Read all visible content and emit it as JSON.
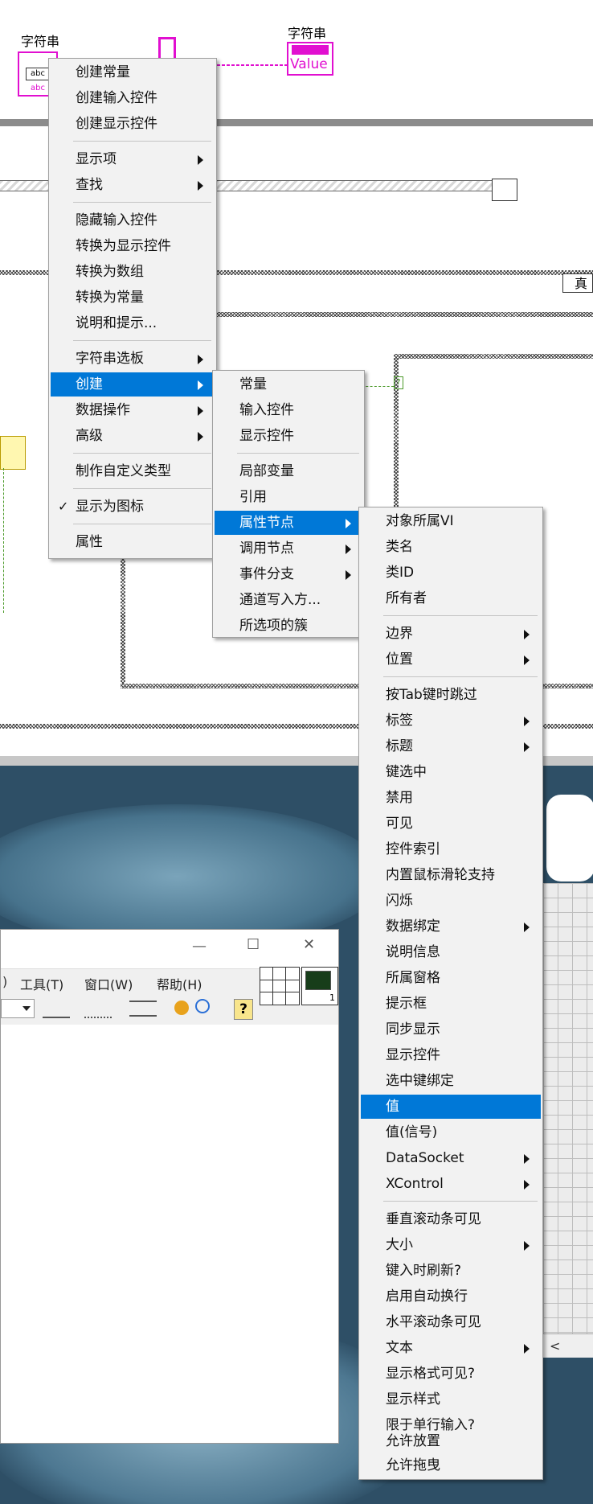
{
  "diagram": {
    "string_label_left": "字符串",
    "string_label_right": "字符串",
    "indicator_value": "Value",
    "abc_tag": "abc",
    "abc_tag2": "abc",
    "case_true_label": "真",
    "question_mark": "?"
  },
  "menu1": {
    "items": [
      {
        "label": "创建常量"
      },
      {
        "label": "创建输入控件"
      },
      {
        "label": "创建显示控件"
      },
      {
        "label": "显示项",
        "submenu": true
      },
      {
        "label": "查找",
        "submenu": true
      },
      {
        "label": "隐藏输入控件"
      },
      {
        "label": "转换为显示控件"
      },
      {
        "label": "转换为数组"
      },
      {
        "label": "转换为常量"
      },
      {
        "label": "说明和提示..."
      },
      {
        "label": "字符串选板",
        "submenu": true
      },
      {
        "label": "创建",
        "submenu": true,
        "highlighted": true
      },
      {
        "label": "数据操作",
        "submenu": true
      },
      {
        "label": "高级",
        "submenu": true
      },
      {
        "label": "制作自定义类型"
      },
      {
        "label": "显示为图标",
        "checked": true
      },
      {
        "label": "属性"
      }
    ],
    "check_glyph": "✓"
  },
  "menu2": {
    "items": [
      {
        "label": "常量"
      },
      {
        "label": "输入控件"
      },
      {
        "label": "显示控件"
      },
      {
        "label": "局部变量"
      },
      {
        "label": "引用"
      },
      {
        "label": "属性节点",
        "submenu": true,
        "highlighted": true
      },
      {
        "label": "调用节点",
        "submenu": true
      },
      {
        "label": "事件分支",
        "submenu": true
      },
      {
        "label": "通道写入方..."
      },
      {
        "label": "所选项的簇"
      }
    ]
  },
  "menu3": {
    "items": [
      {
        "label": "对象所属VI"
      },
      {
        "label": "类名"
      },
      {
        "label": "类ID"
      },
      {
        "label": "所有者"
      },
      {
        "label": "边界",
        "submenu": true
      },
      {
        "label": "位置",
        "submenu": true
      },
      {
        "label": "按Tab键时跳过"
      },
      {
        "label": "标签",
        "submenu": true
      },
      {
        "label": "标题",
        "submenu": true
      },
      {
        "label": "键选中"
      },
      {
        "label": "禁用"
      },
      {
        "label": "可见"
      },
      {
        "label": "控件索引"
      },
      {
        "label": "内置鼠标滑轮支持"
      },
      {
        "label": "闪烁"
      },
      {
        "label": "数据绑定",
        "submenu": true
      },
      {
        "label": "说明信息"
      },
      {
        "label": "所属窗格"
      },
      {
        "label": "提示框"
      },
      {
        "label": "同步显示"
      },
      {
        "label": "显示控件"
      },
      {
        "label": "选中键绑定"
      },
      {
        "label": "值",
        "highlighted": true
      },
      {
        "label": "值(信号)"
      },
      {
        "label": "DataSocket",
        "submenu": true
      },
      {
        "label": "XControl",
        "submenu": true
      },
      {
        "label": "垂直滚动条可见"
      },
      {
        "label": "大小",
        "submenu": true
      },
      {
        "label": "键入时刷新?"
      },
      {
        "label": "启用自动换行"
      },
      {
        "label": "水平滚动条可见"
      },
      {
        "label": "文本",
        "submenu": true
      },
      {
        "label": "显示格式可见?"
      },
      {
        "label": "显示样式"
      },
      {
        "label": "限于单行输入?"
      },
      {
        "label": "允许放置"
      },
      {
        "label": "允许拖曳"
      }
    ]
  },
  "window": {
    "menus": [
      {
        "label": "工具(T)"
      },
      {
        "label": "窗口(W)"
      },
      {
        "label": "帮助(H)"
      }
    ],
    "menu_fragment": ")",
    "minimize": "—",
    "maximize": "☐",
    "close": "✕",
    "help_glyph": "?",
    "vi_icon_number": "1",
    "left_scroll_arrow": "<"
  },
  "colors": {
    "highlight": "#0078d7",
    "string_wire": "#e10fd0",
    "menu_bg": "#f2f2f2"
  }
}
